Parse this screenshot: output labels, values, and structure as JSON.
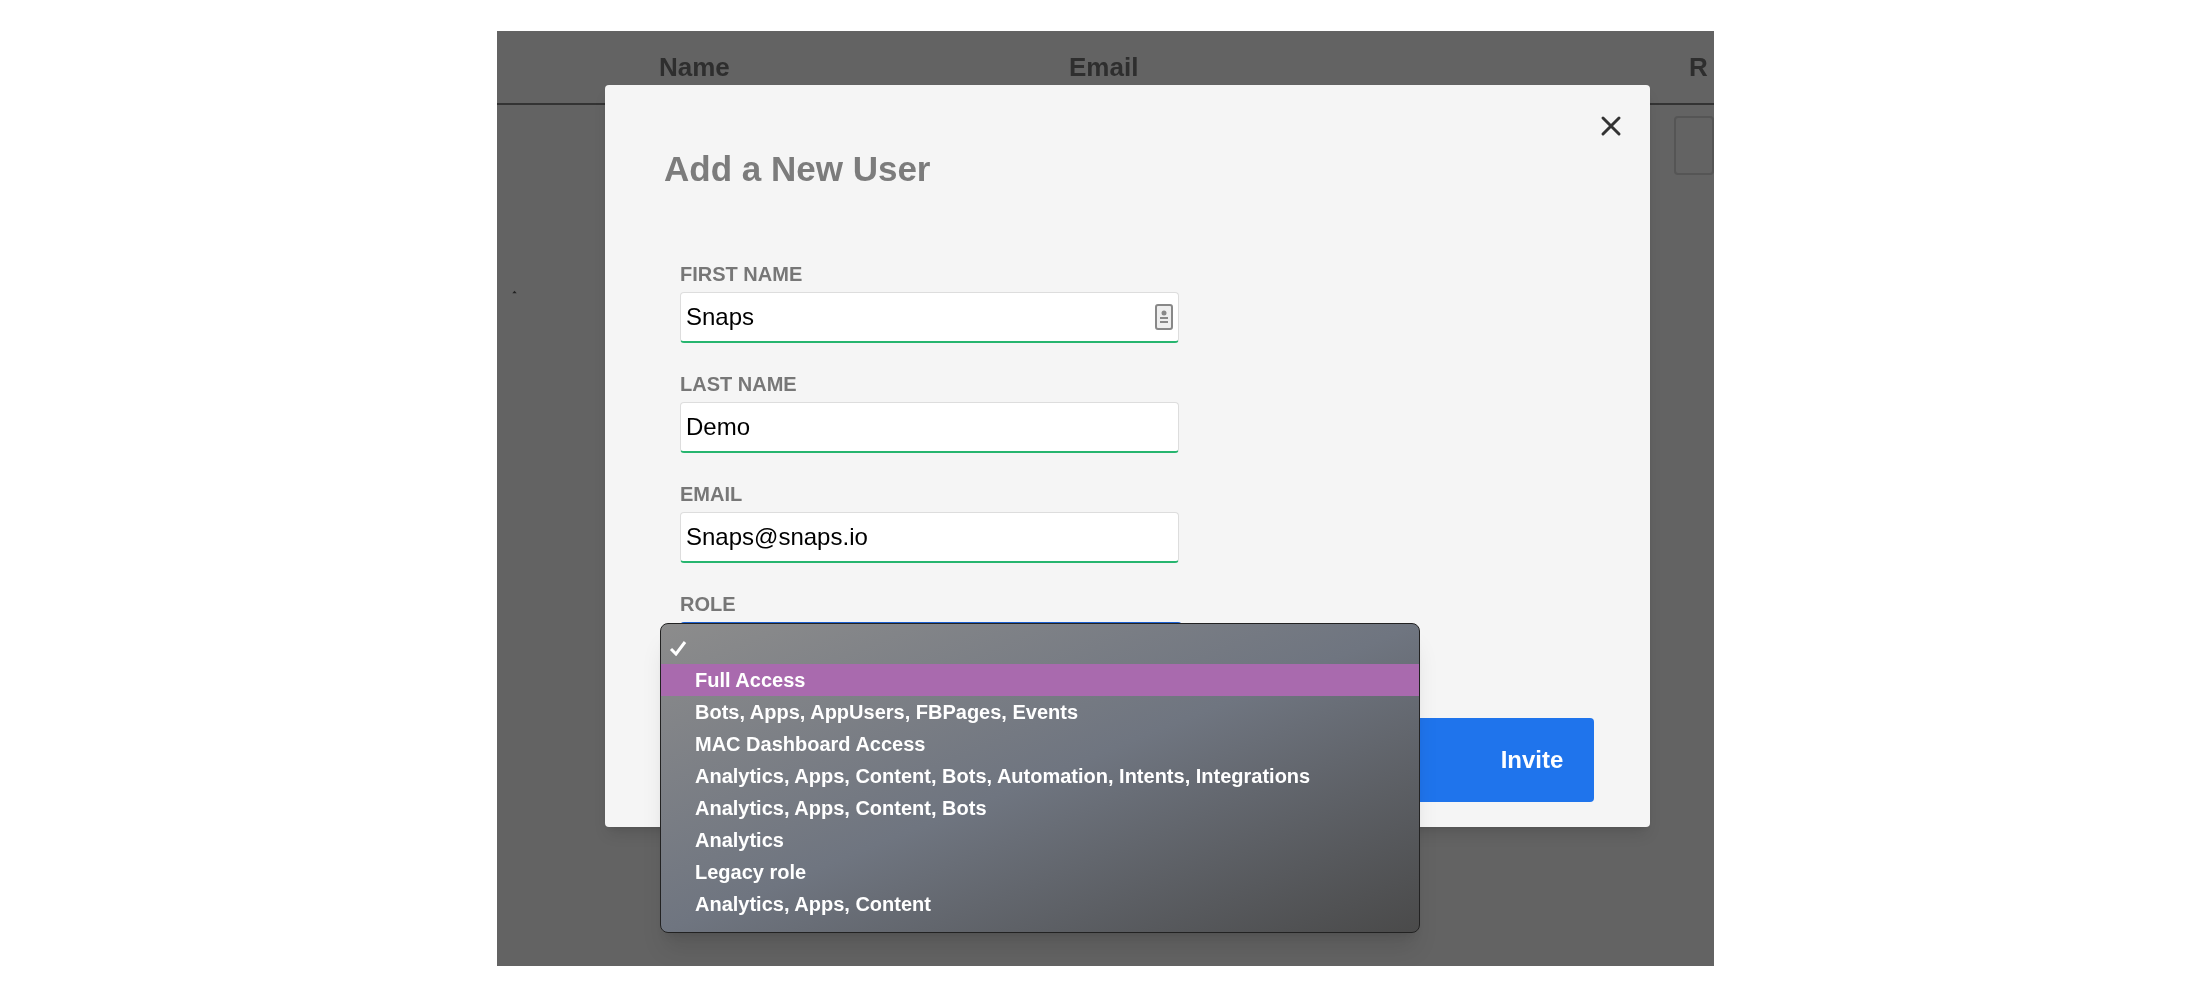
{
  "table": {
    "columns": [
      "Name",
      "Email",
      "R"
    ]
  },
  "dialog": {
    "title": "Add a New User",
    "fields": [
      {
        "label": "FIRST NAME",
        "value": "Snaps",
        "kind": "text",
        "autofill": true
      },
      {
        "label": "LAST NAME",
        "value": "Demo",
        "kind": "text",
        "autofill": false
      },
      {
        "label": "EMAIL",
        "value": "Snaps@snaps.io",
        "kind": "text",
        "autofill": false
      },
      {
        "label": "ROLE",
        "kind": "select",
        "expanded": true
      }
    ],
    "button": "Invite"
  },
  "role_menu": {
    "options": [
      {
        "checked": true,
        "selected": false
      },
      {
        "label": "Full Access",
        "checked": false,
        "selected": true
      },
      {
        "label": "Bots, Apps, AppUsers, FBPages, Events",
        "checked": false,
        "selected": false
      },
      {
        "label": "MAC Dashboard Access",
        "checked": false,
        "selected": false
      },
      {
        "label": "Analytics, Apps, Content, Bots, Automation, Intents, Integrations",
        "checked": false,
        "selected": false
      },
      {
        "label": "Analytics, Apps, Content, Bots",
        "checked": false,
        "selected": false
      },
      {
        "label": "Analytics",
        "checked": false,
        "selected": false
      },
      {
        "label": "Legacy role",
        "checked": false,
        "selected": false
      },
      {
        "label": "Analytics, Apps, Content",
        "checked": false,
        "selected": false
      }
    ]
  }
}
